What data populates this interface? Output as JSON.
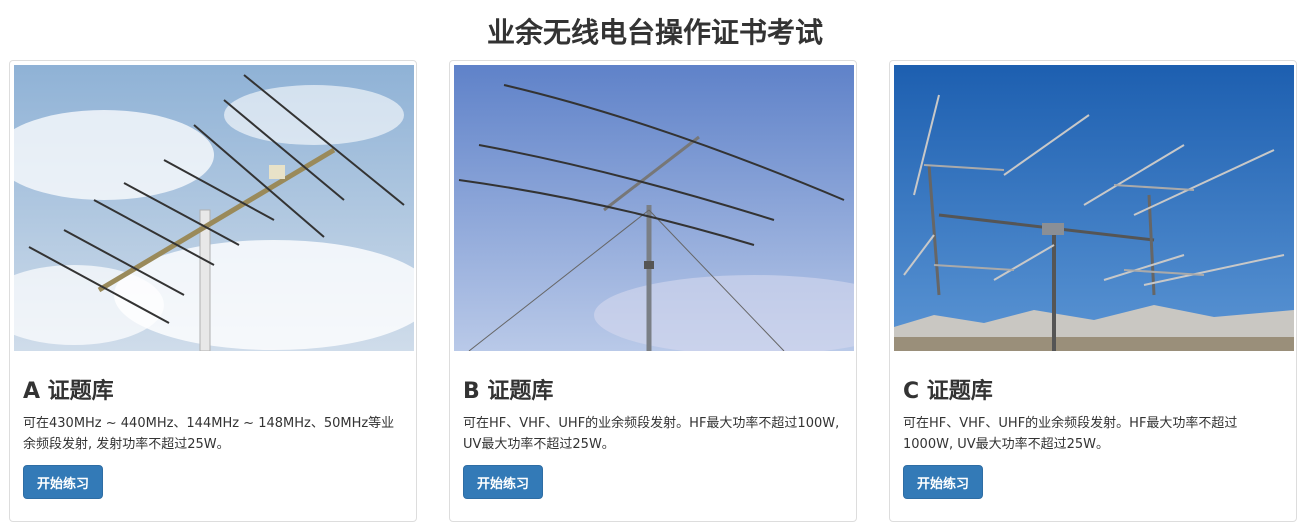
{
  "page": {
    "title": "业余无线电台操作证书考试"
  },
  "cards": [
    {
      "title": "A 证题库",
      "description": "可在430MHz ~ 440MHz、144MHz ~ 148MHz、50MHz等业余频段发射, 发射功率不超过25W。",
      "button_label": "开始练习"
    },
    {
      "title": "B 证题库",
      "description": "可在HF、VHF、UHF的业余频段发射。HF最大功率不超过100W, UV最大功率不超过25W。",
      "button_label": "开始练习"
    },
    {
      "title": "C 证题库",
      "description": "可在HF、VHF、UHF的业余频段发射。HF最大功率不超过1000W, UV最大功率不超过25W。",
      "button_label": "开始练习"
    }
  ],
  "colors": {
    "primary_button": "#337ab7",
    "card_border": "#dddddd",
    "text": "#333333"
  }
}
